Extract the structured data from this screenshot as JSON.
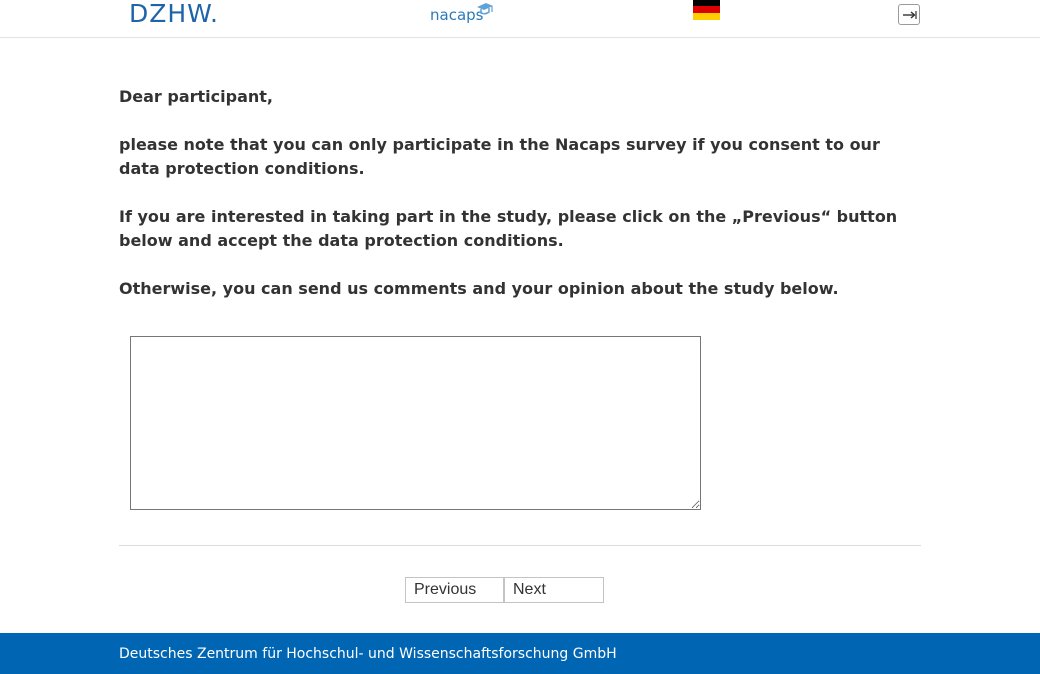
{
  "header": {
    "dzhw_logo": "DZHW.",
    "nacaps_logo": "nacaps",
    "flag": "german-flag",
    "flag_colors": [
      "#000000",
      "#dd0000",
      "#ffce00"
    ],
    "logout_icon": "logout-icon"
  },
  "main": {
    "greeting": "Dear participant,",
    "paragraph_1": "please note that you can only participate in the Nacaps survey if you consent to our data protection conditions.",
    "paragraph_2": "If you are interested in taking part in the study, please click on the „Previous“ button below and accept the data protection conditions.",
    "paragraph_3": "Otherwise, you can send us comments and your opinion about the study below.",
    "comment_value": "",
    "comment_placeholder": ""
  },
  "navigation": {
    "previous_label": "Previous",
    "next_label": "Next"
  },
  "footer": {
    "text": "Deutsches Zentrum für Hochschul- und Wissenschaftsforschung GmbH"
  },
  "colors": {
    "brand_blue": "#0065b2",
    "logo_blue": "#1f63a8",
    "text": "#333333"
  }
}
